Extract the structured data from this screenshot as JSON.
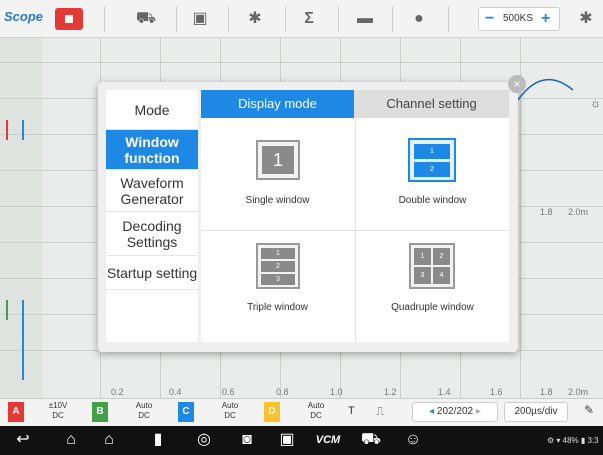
{
  "app": {
    "logo_text": "Scope",
    "logo_accent": "o"
  },
  "toolbar": {
    "icons": [
      "car-icon",
      "screenshot-icon",
      "gear-icon",
      "sigma-icon",
      "folder-icon",
      "help-icon",
      "settings-icon"
    ],
    "sample_rate": "500KS",
    "minus": "−",
    "plus": "+"
  },
  "scope": {
    "x_ticks": [
      "0.2",
      "0.4",
      "0.6",
      "0.8",
      "1.0",
      "1.2",
      "1.4",
      "1.6",
      "1.8",
      "2.0m"
    ],
    "upper_right_ticks": [
      "1.8",
      "2.0m"
    ]
  },
  "dialog": {
    "close": "×",
    "menu": [
      {
        "label": "Mode",
        "active": false
      },
      {
        "label": "Window function",
        "active": true
      },
      {
        "label": "Waveform Generator",
        "active": false
      },
      {
        "label": "Decoding Settings",
        "active": false
      },
      {
        "label": "Startup setting",
        "active": false
      }
    ],
    "tabs": {
      "display_mode": "Display mode",
      "channel_setting": "Channel setting"
    },
    "options": {
      "single": {
        "label": "Single window",
        "numbers": [
          "1"
        ]
      },
      "double": {
        "label": "Double window",
        "numbers": [
          "1",
          "2"
        ]
      },
      "triple": {
        "label": "Triple window",
        "numbers": [
          "1",
          "2",
          "3"
        ]
      },
      "quad": {
        "label": "Quadruple window",
        "numbers": [
          "1",
          "2",
          "3",
          "4"
        ]
      }
    }
  },
  "channels": {
    "a": {
      "letter": "A",
      "line1": "±10V",
      "line2": "DC",
      "color": "#e53935"
    },
    "b": {
      "letter": "B",
      "line1": "Auto",
      "line2": "DC",
      "color": "#43a047"
    },
    "c": {
      "letter": "C",
      "line1": "Auto",
      "line2": "DC",
      "color": "#1e88e5"
    },
    "d": {
      "letter": "D",
      "line1": "Auto",
      "line2": "DC",
      "color": "#fbc02d"
    }
  },
  "bottom": {
    "trigger": "T",
    "pulse": "⎍",
    "page": "202/202",
    "timebase": "200µs/div"
  },
  "statusbar": {
    "text": "48%"
  }
}
